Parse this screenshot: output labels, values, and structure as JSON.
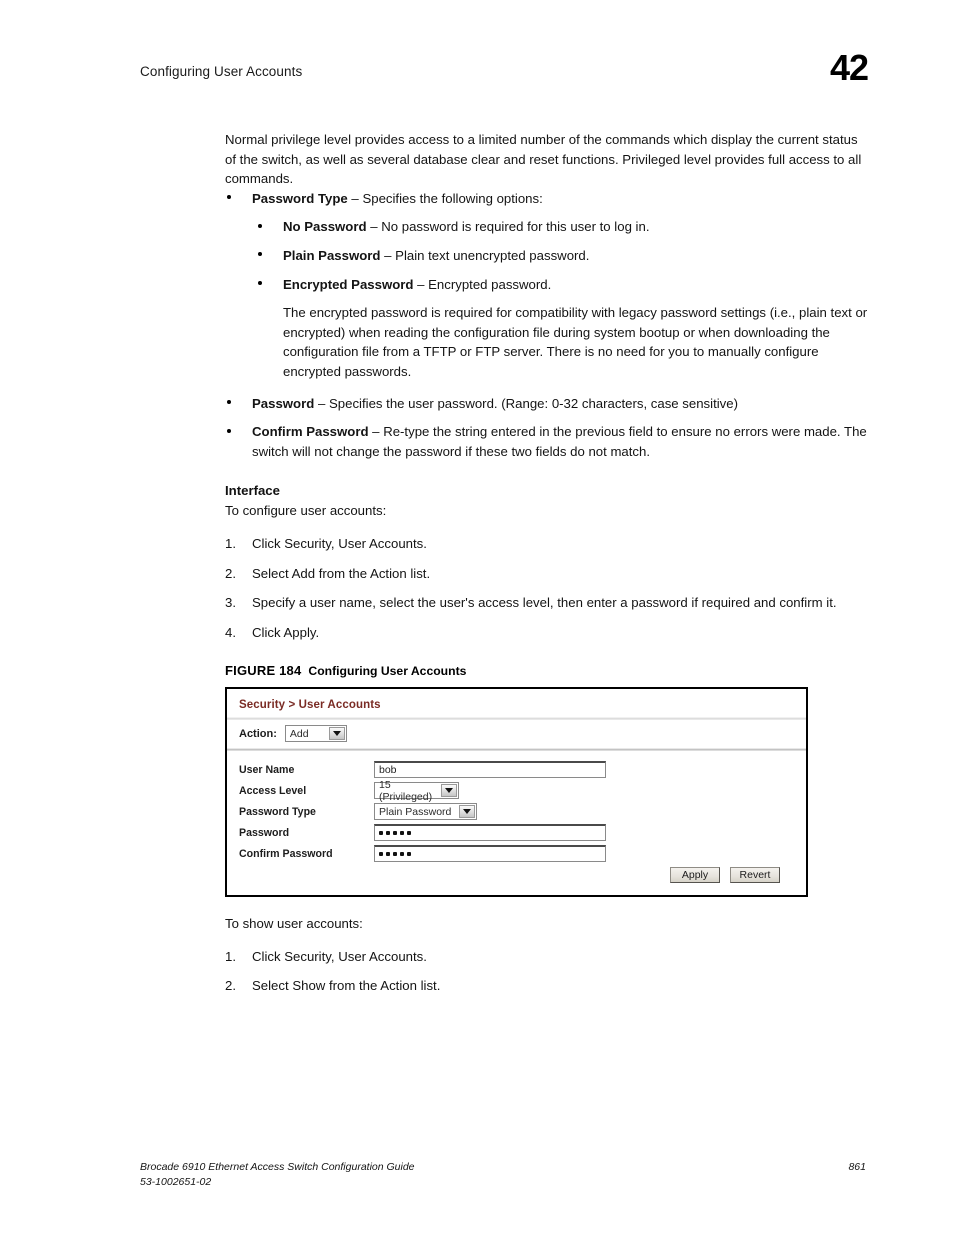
{
  "header": {
    "running_head": "Configuring User Accounts",
    "chapter_number": "42"
  },
  "body": {
    "intro_paragraph": "Normal privilege level provides access to a limited number of the commands which display the current status of the switch, as well as several database clear and reset functions. Privileged level provides full access to all commands.",
    "bullets": [
      {
        "term": "Password Type",
        "dash": " – ",
        "text": "Specifies the following options:"
      },
      {
        "term": "No Password",
        "dash": " – ",
        "text": "No password is required for this user to log in."
      },
      {
        "term": "Plain Password",
        "dash": " – ",
        "text": "Plain text unencrypted password."
      },
      {
        "term": "Encrypted Password",
        "dash": " – ",
        "text": "Encrypted password."
      },
      {
        "term": "Password",
        "dash": " – ",
        "text": "Specifies the user password. (Range: 0-32 characters, case sensitive)"
      },
      {
        "term": "Confirm Password",
        "dash": " – ",
        "text": "Re-type the string entered in the previous field to ensure no errors were made. The switch will not change the password if these two fields do not match."
      }
    ],
    "encrypted_note": "The encrypted password is required for compatibility with legacy password settings (i.e., plain text or encrypted) when reading the configuration file during system bootup or when downloading the configuration file from a TFTP or FTP server. There is no need for you to manually configure encrypted passwords.",
    "interface_heading": "Interface",
    "configure_lead": "To configure user accounts:",
    "configure_steps": [
      {
        "num": "1.",
        "text": "Click Security, User Accounts."
      },
      {
        "num": "2.",
        "text": "Select Add from the Action list."
      },
      {
        "num": "3.",
        "text": "Specify a user name, select the user's access level, then enter a password if required and confirm it."
      },
      {
        "num": "4.",
        "text": "Click Apply."
      }
    ],
    "show_lead": "To show user accounts:",
    "show_steps": [
      {
        "num": "1.",
        "text": "Click Security, User Accounts."
      },
      {
        "num": "2.",
        "text": "Select Show from the Action list."
      }
    ]
  },
  "figure": {
    "caption_label": "FIGURE 184",
    "caption_title": "Configuring User Accounts",
    "breadcrumb": "Security > User Accounts",
    "breadcrumb_color": "#7a2b24",
    "action_label": "Action:",
    "action_value": "Add",
    "fields": [
      {
        "label": "User Name",
        "type": "text",
        "value": "bob"
      },
      {
        "label": "Access Level",
        "type": "select",
        "value": "15 (Privileged)"
      },
      {
        "label": "Password Type",
        "type": "select",
        "value": "Plain Password"
      },
      {
        "label": "Password",
        "type": "password",
        "value": "•••••",
        "dots": 5
      },
      {
        "label": "Confirm Password",
        "type": "password",
        "value": "•••••",
        "dots": 5
      }
    ],
    "apply_label": "Apply",
    "revert_label": "Revert"
  },
  "footer": {
    "guide_title": "Brocade 6910 Ethernet Access Switch Configuration Guide",
    "doc_number": "53-1002651-02",
    "page_number": "861"
  }
}
